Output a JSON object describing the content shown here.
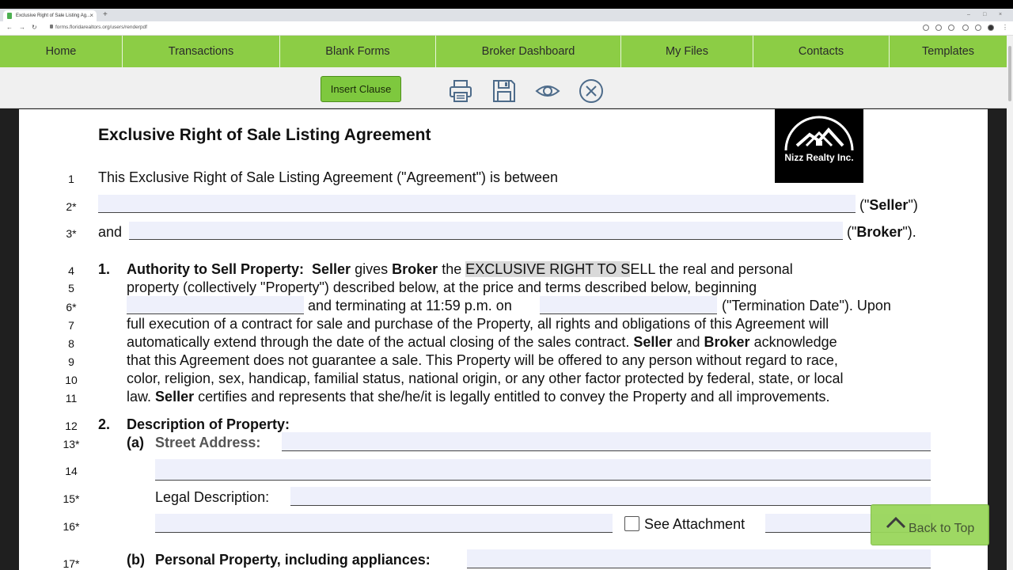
{
  "browser": {
    "tab_title": "Exclusive Right of Sale Listing Ag...",
    "url": "forms.floridarealtors.org/users/renderpdf"
  },
  "menu": {
    "items": [
      "Home",
      "Transactions",
      "Blank Forms",
      "Broker Dashboard",
      "My Files",
      "Contacts",
      "Templates"
    ]
  },
  "toolbar": {
    "insert_clause": "Insert Clause",
    "icons": [
      "print-icon",
      "save-icon",
      "eye-icon",
      "close-icon"
    ]
  },
  "document": {
    "title": "Exclusive Right of Sale Listing Agreement",
    "logo_text": "Nizz Realty Inc.",
    "line_numbers": [
      "1",
      "2*",
      "3*",
      "4",
      "5",
      "6*",
      "7",
      "8",
      "9",
      "10",
      "11",
      "12",
      "13*",
      "14",
      "15*",
      "16*",
      "17*"
    ],
    "line1": "This Exclusive Right of Sale Listing Agreement (\"Agreement\") is between",
    "seller_open": "(\"",
    "seller_bold": "Seller",
    "seller_close": "\")",
    "and": "and",
    "broker_open": "(\"",
    "broker_bold": "Broker",
    "broker_close": "\").",
    "s1": {
      "num": "1.",
      "heading": "Authority to Sell Property:",
      "seller": "Seller",
      "gives": "gives",
      "broker": "Broker",
      "the": "the",
      "highlight": "EXCLUSIVE RIGHT TO S",
      "after_hl": "ELL the real and personal",
      "line5": "property (collectively \"Property\") described below, at the price and terms described below, beginning",
      "terminating": "and terminating at 11:59 p.m. on",
      "termination_date": "(\"Termination Date\"). Upon",
      "line7": "full execution of a contract for sale and purchase of the Property, all rights and obligations of this Agreement will",
      "line8a": "automatically extend through the date of the actual closing of the sales contract.",
      "line8_seller": "Seller",
      "line8_and": "and",
      "line8_broker": "Broker",
      "line8b": "acknowledge",
      "line9": "that this Agreement does not guarantee a sale. This Property will be offered to any person without regard to race,",
      "line10": "color, religion, sex, handicap, familial status, national origin, or any other factor protected by federal, state, or local",
      "line11a": "law.",
      "line11_seller": "Seller",
      "line11b": "certifies and represents that she/he/it is legally entitled to convey the Property and all improvements."
    },
    "s2": {
      "num": "2.",
      "heading": "Description of Property:",
      "a": "(a)",
      "street": "Street Address:",
      "legal": "Legal Description:",
      "see_attachment": "See Attachment",
      "b": "(b)",
      "personal": "Personal Property, including appliances:"
    }
  },
  "back_to_top": "Back to Top"
}
